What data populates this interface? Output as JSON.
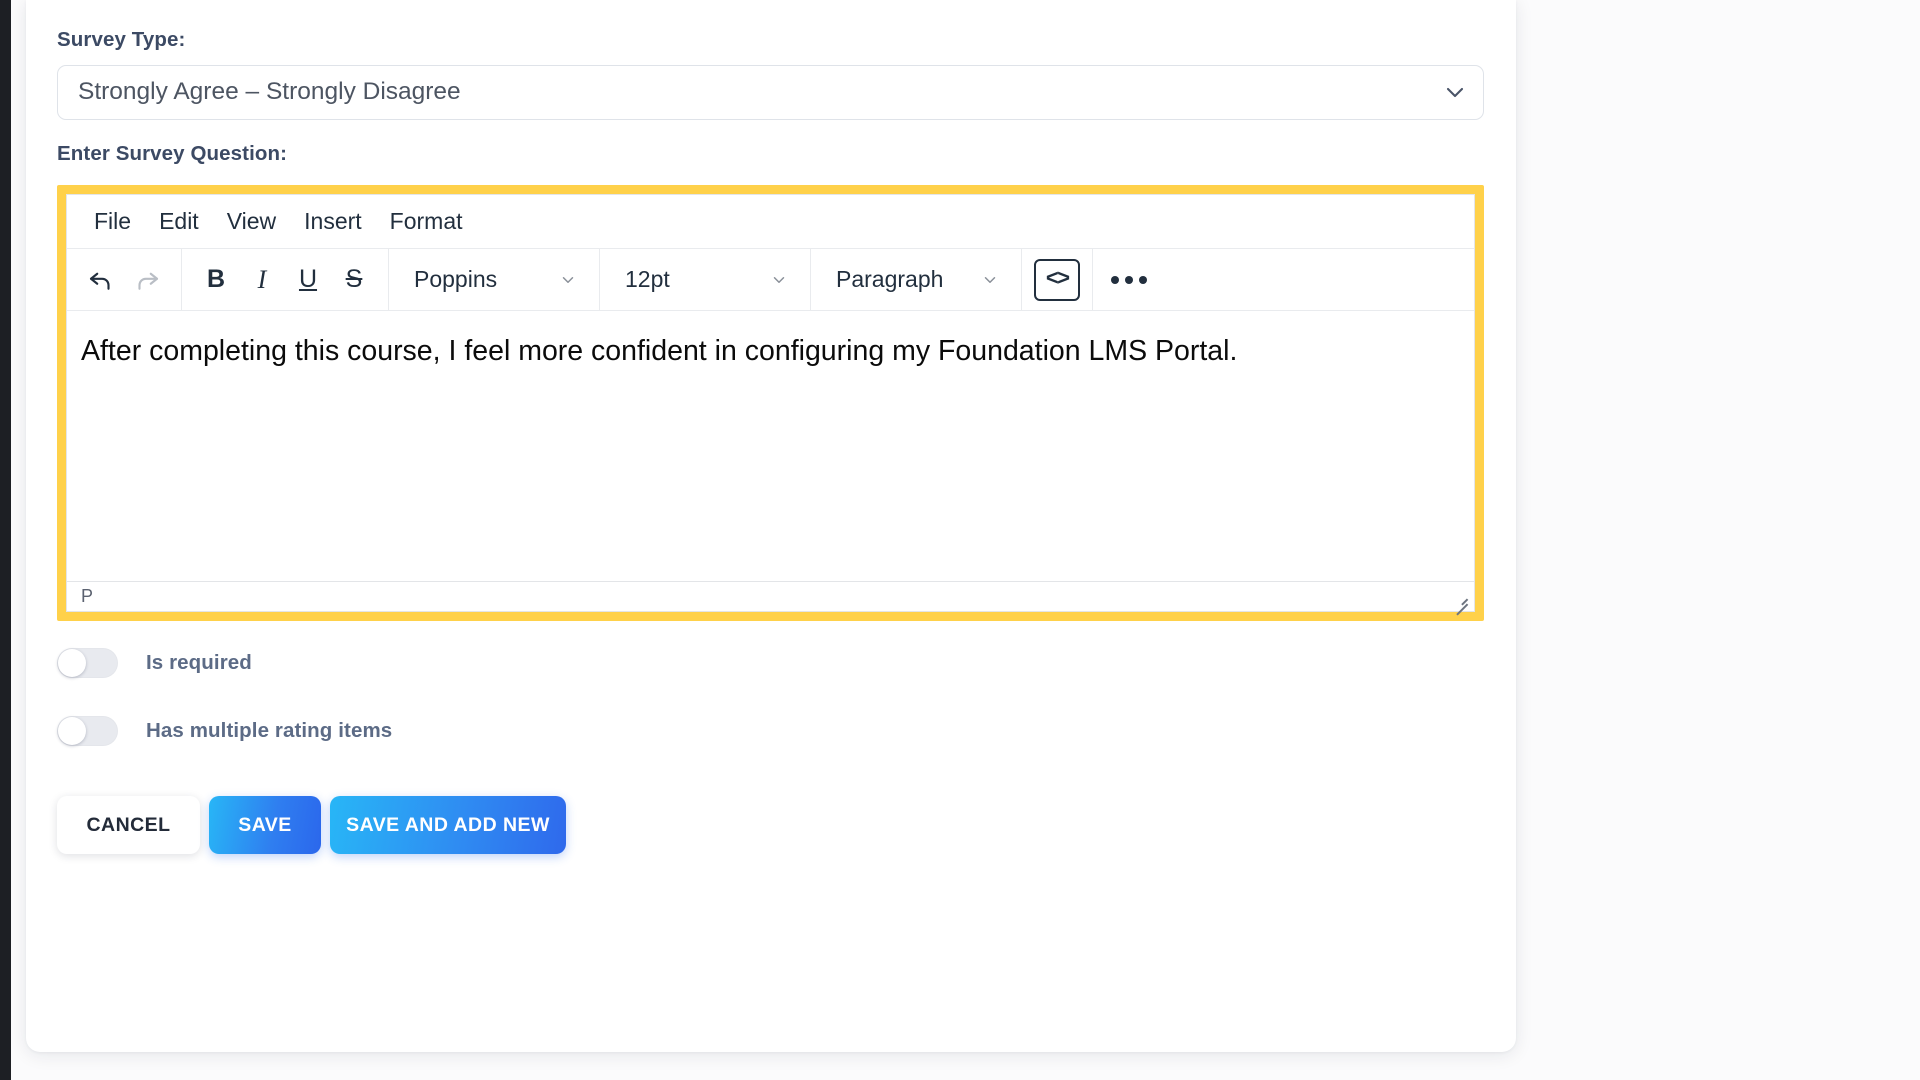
{
  "survey_type": {
    "label": "Survey Type:",
    "selected": "Strongly Agree – Strongly Disagree",
    "chevron_icon": "chevron-down-icon"
  },
  "question": {
    "label": "Enter Survey Question:",
    "editor": {
      "menubar": [
        "File",
        "Edit",
        "View",
        "Insert",
        "Format"
      ],
      "toolbar": {
        "undo_icon": "undo-arrow-icon",
        "redo_icon": "redo-arrow-icon",
        "bold_label": "B",
        "italic_label": "I",
        "underline_label": "U",
        "strikethrough_label": "S",
        "font_family": "Poppins",
        "font_size": "12pt",
        "block_format": "Paragraph",
        "source_code_label": "<>",
        "more_label": "…"
      },
      "content": "After completing this course, I feel more confident in configuring my Foundation LMS Portal.",
      "status_path": "P",
      "focus_ring_color": "#FFD14A"
    }
  },
  "toggles": [
    {
      "label": "Is required",
      "state": "off"
    },
    {
      "label": "Has multiple rating items",
      "state": "off"
    }
  ],
  "actions": {
    "cancel": "CANCEL",
    "save": "SAVE",
    "save_and_add_new": "SAVE AND ADD NEW"
  },
  "colors": {
    "accent_yellow": "#FFD14A",
    "primary_blue": "#2F7EF0",
    "cyan": "#28B6F6",
    "label_navy": "#3C4A64",
    "toggle_label": "#5C6B86"
  }
}
